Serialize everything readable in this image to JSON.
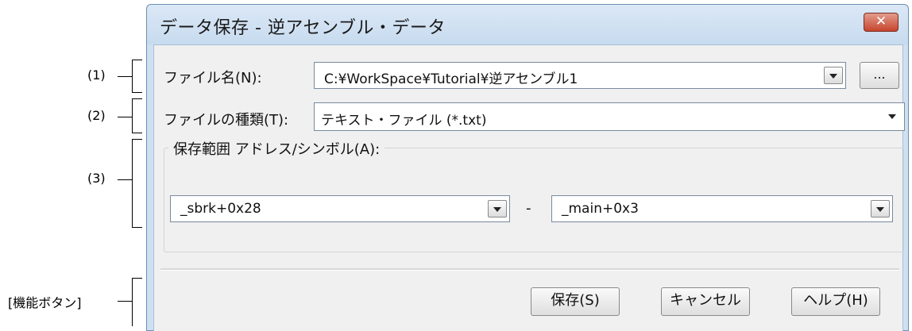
{
  "callouts": {
    "c1": "(1)",
    "c2": "(2)",
    "c3": "(3)",
    "c4": "[機能ボタン]"
  },
  "dialog": {
    "title": "データ保存 - 逆アセンブル・データ",
    "close_glyph": "✕",
    "filename_label": "ファイル名(N):",
    "filename_value": "C:¥WorkSpace¥Tutorial¥逆アセンブル1",
    "browse_label": "...",
    "filetype_label": "ファイルの種類(T):",
    "filetype_value": "テキスト・ファイル (*.txt)",
    "range_group_title": "保存範囲 アドレス/シンボル(A):",
    "range_start": "_sbrk+0x28",
    "range_dash": "-",
    "range_end": "_main+0x3",
    "save_label": "保存(S)",
    "cancel_label": "キャンセル",
    "help_label": "ヘルプ(H)"
  },
  "colors": {
    "titlebar": "#c7dbef",
    "client": "#f0f0f0",
    "close_button": "#c7452e"
  }
}
